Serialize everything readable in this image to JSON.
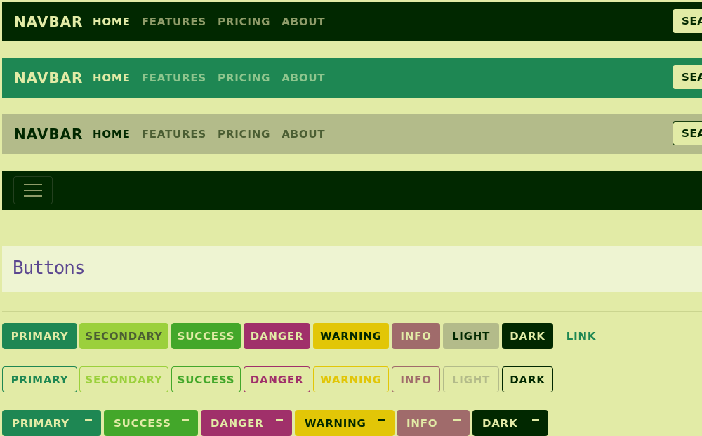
{
  "navbars": [
    {
      "brand": "NAVBAR",
      "links": [
        "HOME",
        "FEATURES",
        "PRICING",
        "ABOUT"
      ],
      "active": 0,
      "search_label": "SEARCH"
    },
    {
      "brand": "NAVBAR",
      "links": [
        "HOME",
        "FEATURES",
        "PRICING",
        "ABOUT"
      ],
      "active": 0,
      "search_label": "SEARCH"
    },
    {
      "brand": "NAVBAR",
      "links": [
        "HOME",
        "FEATURES",
        "PRICING",
        "ABOUT"
      ],
      "active": 0,
      "search_label": "SEARCH"
    }
  ],
  "section": {
    "title": "Buttons"
  },
  "buttons_solid": [
    "PRIMARY",
    "SECONDARY",
    "SUCCESS",
    "DANGER",
    "WARNING",
    "INFO",
    "LIGHT",
    "DARK",
    "LINK"
  ],
  "buttons_outline": [
    "PRIMARY",
    "SECONDARY",
    "SUCCESS",
    "DANGER",
    "WARNING",
    "INFO",
    "LIGHT",
    "DARK"
  ],
  "buttons_dropdown": [
    "PRIMARY",
    "SUCCESS",
    "DANGER",
    "WARNING",
    "INFO",
    "DARK"
  ],
  "colors": {
    "background": "#e2eba6",
    "primary": "#1e8753",
    "secondary": "#9bd03c",
    "success": "#43a72a",
    "danger": "#a0306a",
    "warning": "#e2c607",
    "info": "#a06b6b",
    "light": "#b3bb8a",
    "dark": "#012800",
    "heading": "#5b4790"
  }
}
